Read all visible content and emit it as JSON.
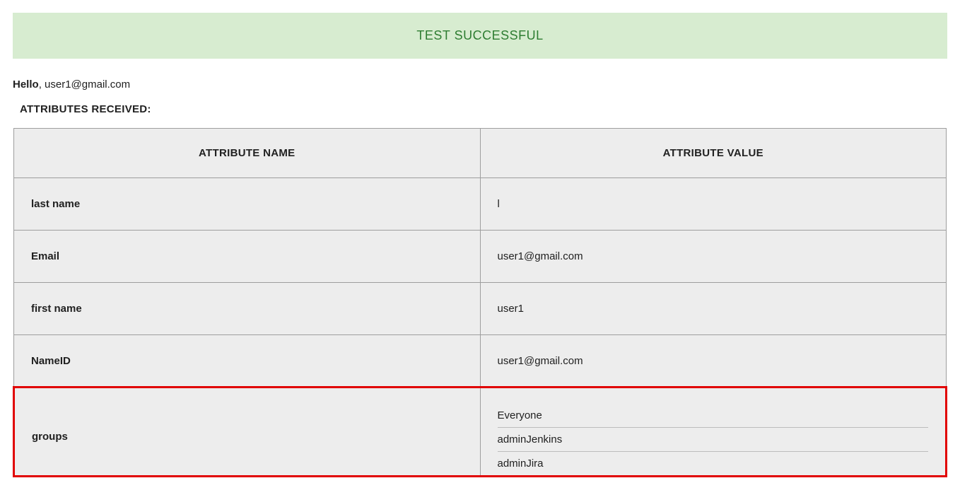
{
  "banner": {
    "text": "TEST SUCCESSFUL"
  },
  "greeting": {
    "prefix": "Hello",
    "separator": ", ",
    "user": "user1@gmail.com"
  },
  "section_title": "ATTRIBUTES RECEIVED:",
  "table": {
    "headers": {
      "name": "ATTRIBUTE NAME",
      "value": "ATTRIBUTE VALUE"
    },
    "rows": [
      {
        "name": "last name",
        "value": "l"
      },
      {
        "name": "Email",
        "value": "user1@gmail.com"
      },
      {
        "name": "first name",
        "value": "user1"
      },
      {
        "name": "NameID",
        "value": "user1@gmail.com"
      }
    ],
    "highlighted_row": {
      "name": "groups",
      "values": [
        "Everyone",
        "adminJenkins",
        "adminJira"
      ]
    }
  }
}
